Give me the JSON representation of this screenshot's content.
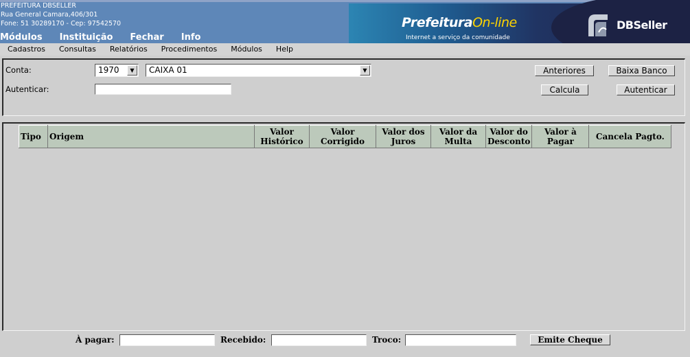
{
  "header": {
    "institution": "PREFEITURA DBSELLER",
    "address": "Rua General Camara,406/301",
    "phone": "Fone: 51 30289170  -  Cep: 97542570",
    "menu": [
      "Módulos",
      "Instituição",
      "Fechar",
      "Info"
    ],
    "banner": {
      "prefeitura": "Prefeitura",
      "online": "On-line",
      "tagline": "Internet a serviço da comunidade",
      "brand": "DBSeller"
    }
  },
  "menubar": [
    "Cadastros",
    "Consultas",
    "Relatórios",
    "Procedimentos",
    "Módulos",
    "Help"
  ],
  "form": {
    "conta_label": "Conta:",
    "conta_code": "1970",
    "conta_name": "CAIXA 01",
    "autenticar_label": "Autenticar:",
    "autenticar_value": "",
    "buttons": {
      "anteriores": "Anteriores",
      "baixa_banco": "Baixa Banco",
      "calcula": "Calcula",
      "autenticar": "Autenticar"
    }
  },
  "table": {
    "columns": [
      "Tipo",
      "Origem",
      "Valor Histórico",
      "Valor Corrigido",
      "Valor dos Juros",
      "Valor da Multa",
      "Valor do Desconto",
      "Valor à Pagar",
      "Cancela Pagto."
    ],
    "rows": []
  },
  "footer": {
    "a_pagar_label": "À pagar:",
    "a_pagar_value": "",
    "recebido_label": "Recebido:",
    "recebido_value": "",
    "troco_label": "Troco:",
    "troco_value": "",
    "emite_cheque": "Emite Cheque"
  }
}
